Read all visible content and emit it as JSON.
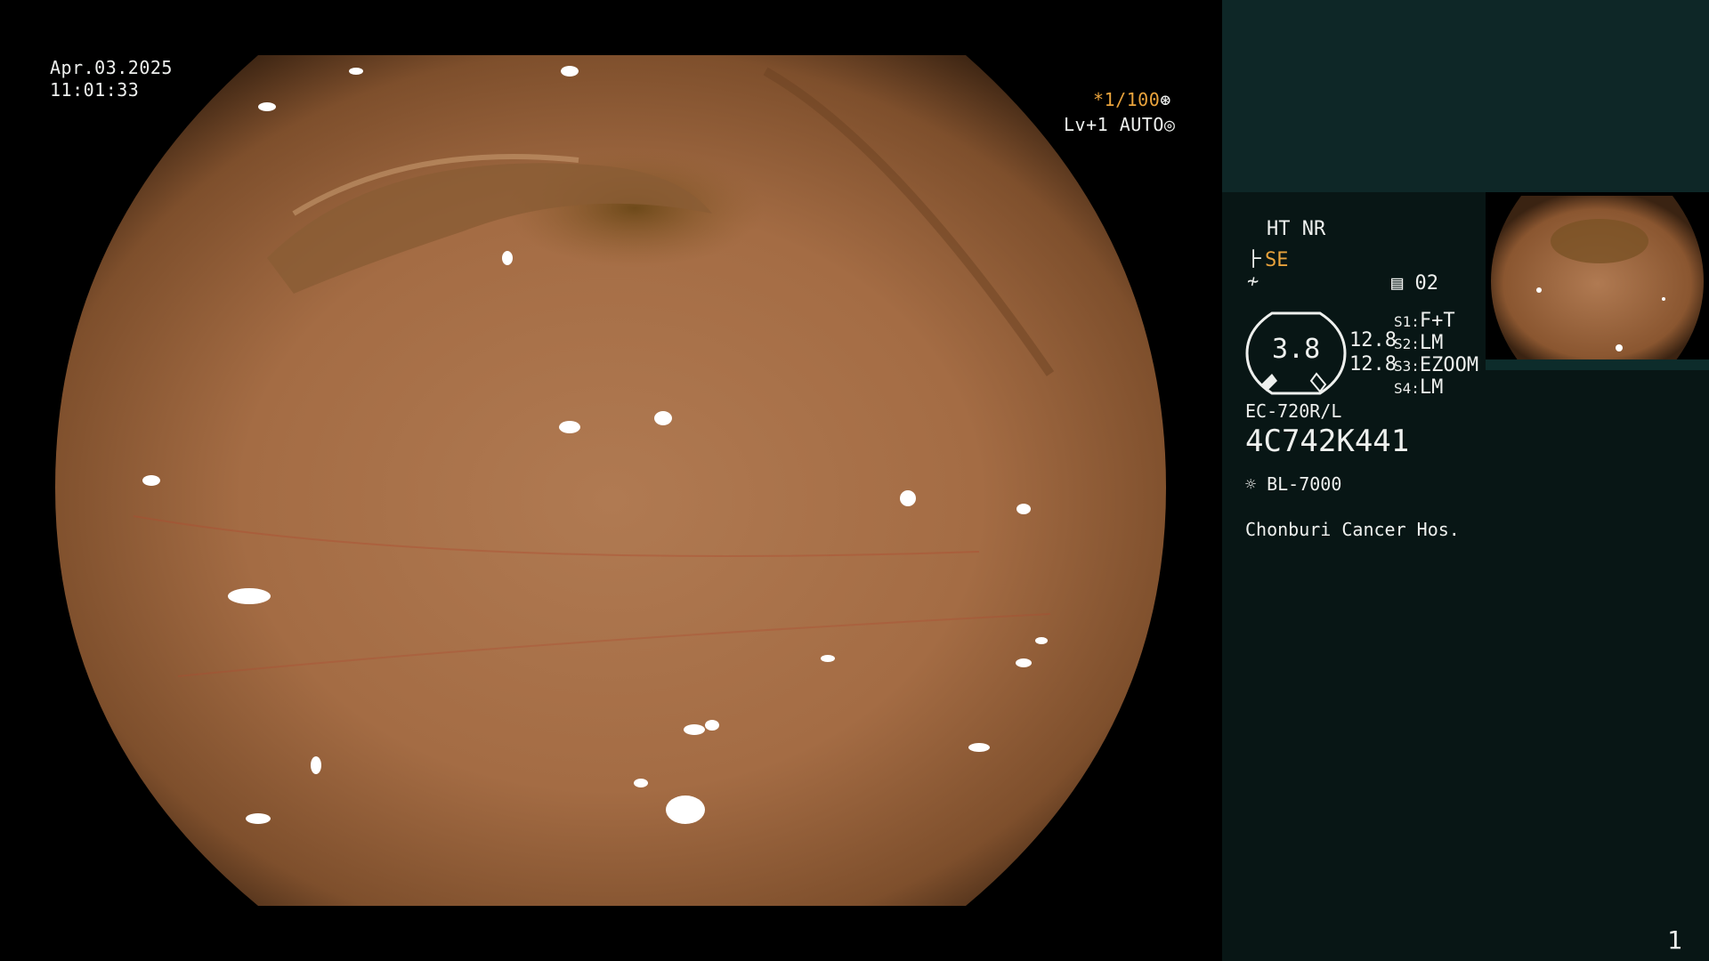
{
  "overlay": {
    "date": "Apr.03.2025",
    "time": "11:01:33",
    "shutter": "*1/100",
    "level": "Lv+1 AUTO"
  },
  "panel": {
    "ht_nr": "HT NR",
    "se": "SE",
    "preset_num": "02",
    "zoom_value": "3.8",
    "val_top": "12.8",
    "val_bottom": "12.8",
    "s1_label": "S1:",
    "s1_value": "F+T",
    "s2_label": "S2:",
    "s2_value": "LM",
    "s3_label": "S3:",
    "s3_value": "EZOOM",
    "s4_label": "S4:",
    "s4_value": "LM",
    "scope_model": "EC-720R/L",
    "serial": "4C742K441",
    "light_source": "BL-7000",
    "hospital": "Chonburi Cancer Hos.",
    "page_number": "1"
  },
  "icons": {
    "aperture": "aperture-icon",
    "iris": "iris-icon",
    "enhance": "structure-enhance-icon",
    "color": "color-mode-icon",
    "memo": "memo-icon",
    "lamp": "lamp-icon"
  },
  "colors": {
    "panel_bg": "#081615",
    "panel_top_bg": "#0e2727",
    "accent_orange": "#e9a33c",
    "text": "#eef0ee"
  }
}
